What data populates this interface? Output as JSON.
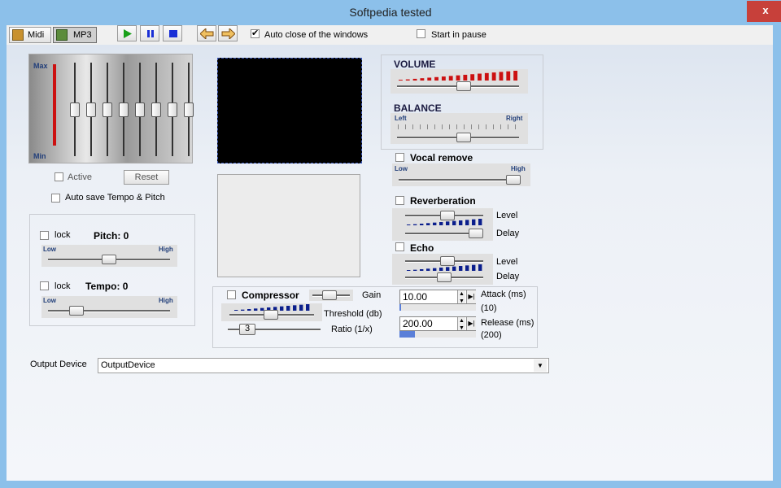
{
  "window": {
    "title": "Softpedia tested",
    "close_glyph": "x"
  },
  "toolbar": {
    "midi_label": "Midi",
    "mp3_label": "MP3",
    "play_icon": "play-icon",
    "pause_icon": "pause-icon",
    "stop_icon": "stop-icon",
    "auto_close_label": "Auto close of the windows",
    "auto_close_checked": true,
    "start_pause_label": "Start in pause",
    "start_pause_checked": false
  },
  "equalizer": {
    "max_label": "Max",
    "min_label": "Min",
    "active_label": "Active",
    "reset_label": "Reset",
    "auto_save_label": "Auto save Tempo & Pitch",
    "band_levels": [
      0.5,
      0.5,
      0.5,
      0.5,
      0.5,
      0.5,
      0.5,
      0.5
    ]
  },
  "pitch": {
    "lock_label": "lock",
    "title": "Pitch: 0",
    "low": "Low",
    "high": "High",
    "level": 0.5
  },
  "tempo": {
    "lock_label": "lock",
    "title": "Tempo: 0",
    "low": "Low",
    "high": "High",
    "level": 0.2
  },
  "volume": {
    "title": "VOLUME",
    "level": 0.55
  },
  "balance": {
    "title": "BALANCE",
    "left": "Left",
    "right": "Right",
    "level": 0.55
  },
  "vocal_remove": {
    "label": "Vocal remove",
    "low": "Low",
    "high": "High",
    "level": 1.0
  },
  "reverberation": {
    "label": "Reverberation",
    "level_label": "Level",
    "delay_label": "Delay",
    "level": 0.55,
    "delay": 1.0
  },
  "echo": {
    "label": "Echo",
    "level_label": "Level",
    "delay_label": "Delay",
    "level": 0.55,
    "delay": 0.5
  },
  "compressor": {
    "label": "Compressor",
    "gain_label": "Gain",
    "threshold_label": "Threshold (db)",
    "ratio_label": "Ratio (1/x)",
    "ratio_value": "3",
    "attack_value": "10.00",
    "attack_label": "Attack (ms)",
    "attack_default": "(10)",
    "release_value": "200.00",
    "release_label": "Release (ms)",
    "release_default": "(200)",
    "release_progress": 0.2
  },
  "output": {
    "label": "Output Device",
    "value": "OutputDevice"
  },
  "colors": {
    "accent_red": "#cc1111",
    "stop_blue": "#1a2fd6",
    "play_green": "#18a018"
  }
}
